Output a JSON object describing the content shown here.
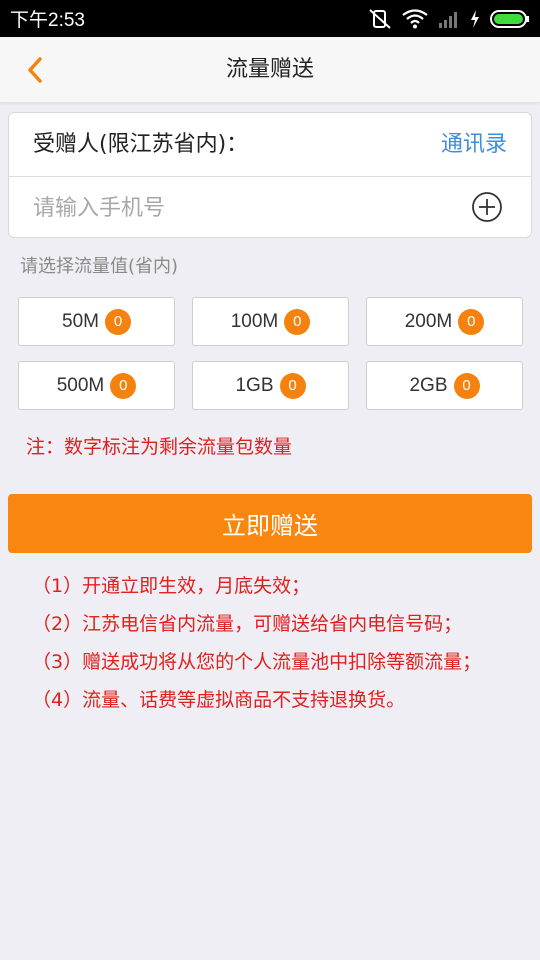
{
  "status_bar": {
    "time": "下午2:53"
  },
  "header": {
    "title": "流量赠送"
  },
  "recipient": {
    "label": "受赠人(限江苏省内)：",
    "contacts_link": "通讯录",
    "phone_placeholder": "请输入手机号",
    "phone_value": ""
  },
  "select_label": "请选择流量值(省内)",
  "options": [
    {
      "label": "50M",
      "count": "0"
    },
    {
      "label": "100M",
      "count": "0"
    },
    {
      "label": "200M",
      "count": "0"
    },
    {
      "label": "500M",
      "count": "0"
    },
    {
      "label": "1GB",
      "count": "0"
    },
    {
      "label": "2GB",
      "count": "0"
    }
  ],
  "note": "注：数字标注为剩余流量包数量",
  "send_button": "立即赠送",
  "rules": [
    "（1）开通立即生效，月底失效；",
    "（2）江苏电信省内流量，可赠送给省内电信号码；",
    "（3）赠送成功将从您的个人流量池中扣除等额流量；",
    "（4）流量、话费等虚拟商品不支持退换货。"
  ],
  "colors": {
    "accent": "#f9860f",
    "badge": "#f5820f",
    "link": "#3f8ede",
    "warning_text": "#e0201e",
    "background": "#efeef4"
  },
  "icons": {
    "back": "chevron-left-icon",
    "add_contact": "plus-circle-icon",
    "mute": "mute-icon",
    "wifi": "wifi-icon",
    "signal": "signal-icon",
    "battery": "battery-icon"
  }
}
